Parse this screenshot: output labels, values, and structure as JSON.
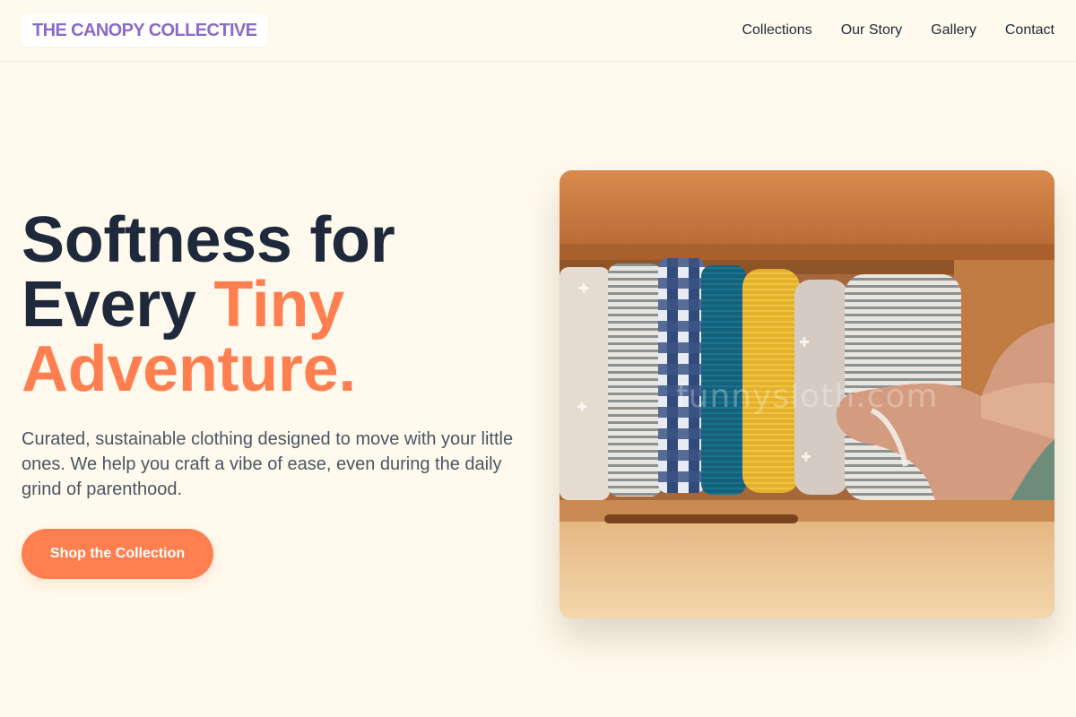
{
  "brand": {
    "logo_text": "THE CANOPY COLLECTIVE"
  },
  "nav": {
    "items": [
      {
        "label": "Collections"
      },
      {
        "label": "Our Story"
      },
      {
        "label": "Gallery"
      },
      {
        "label": "Contact"
      }
    ]
  },
  "hero": {
    "headline_line1": "Softness for",
    "headline_line2_plain": "Every ",
    "headline_line2_accent": "Tiny",
    "headline_line3_accent": "Adventure.",
    "subcopy": "Curated, sustainable clothing designed to move with your little ones. We help you craft a vibe of ease, even during the daily grind of parenthood.",
    "cta_label": "Shop the Collection",
    "image_watermark": "funnysloth.com"
  },
  "colors": {
    "background": "#fffaed",
    "brand_purple": "#8b6ac9",
    "accent_coral": "#ff7f50",
    "heading_navy": "#1e293b",
    "body_gray": "#4b5563"
  },
  "icons": {
    "hero_image": "photo-folded-muslin-blankets-in-drawer"
  }
}
